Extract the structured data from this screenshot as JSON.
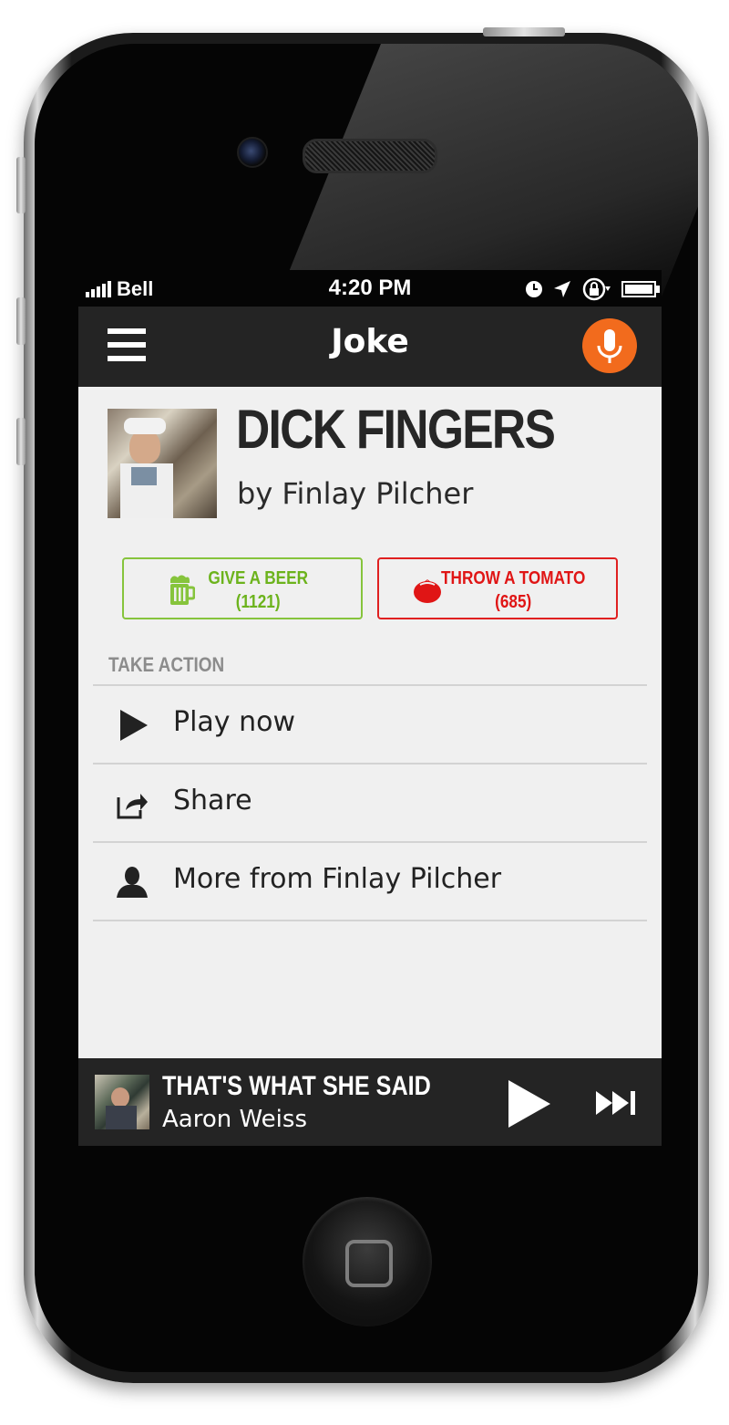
{
  "status_bar": {
    "carrier": "Bell",
    "time": "4:20 PM",
    "icons": [
      "signal-bars-icon",
      "clock-icon",
      "location-arrow-icon",
      "rotation-lock-icon",
      "battery-icon"
    ]
  },
  "navbar": {
    "title": "Joke",
    "menu_icon": "hamburger-menu-icon",
    "mic_icon": "microphone-icon",
    "mic_color": "#f26b1d"
  },
  "joke": {
    "title": "DICK FINGERS",
    "author_line": "by Finlay Pilcher"
  },
  "votes": {
    "beer": {
      "label": "GIVE A BEER",
      "count": "(1121)",
      "icon": "beer-mug-icon",
      "color": "#6cb31c"
    },
    "tomato": {
      "label": "THROW A TOMATO",
      "count": "(685)",
      "icon": "tomato-icon",
      "color": "#e01515"
    }
  },
  "actions": {
    "section_label": "TAKE ACTION",
    "items": [
      {
        "label": "Play now",
        "icon": "play-icon"
      },
      {
        "label": "Share",
        "icon": "share-icon"
      },
      {
        "label": "More from Finlay Pilcher",
        "icon": "person-icon"
      }
    ]
  },
  "player": {
    "title": "THAT'S WHAT SHE SAID",
    "artist": "Aaron Weiss",
    "play_icon": "play-icon",
    "next_icon": "skip-next-icon"
  }
}
